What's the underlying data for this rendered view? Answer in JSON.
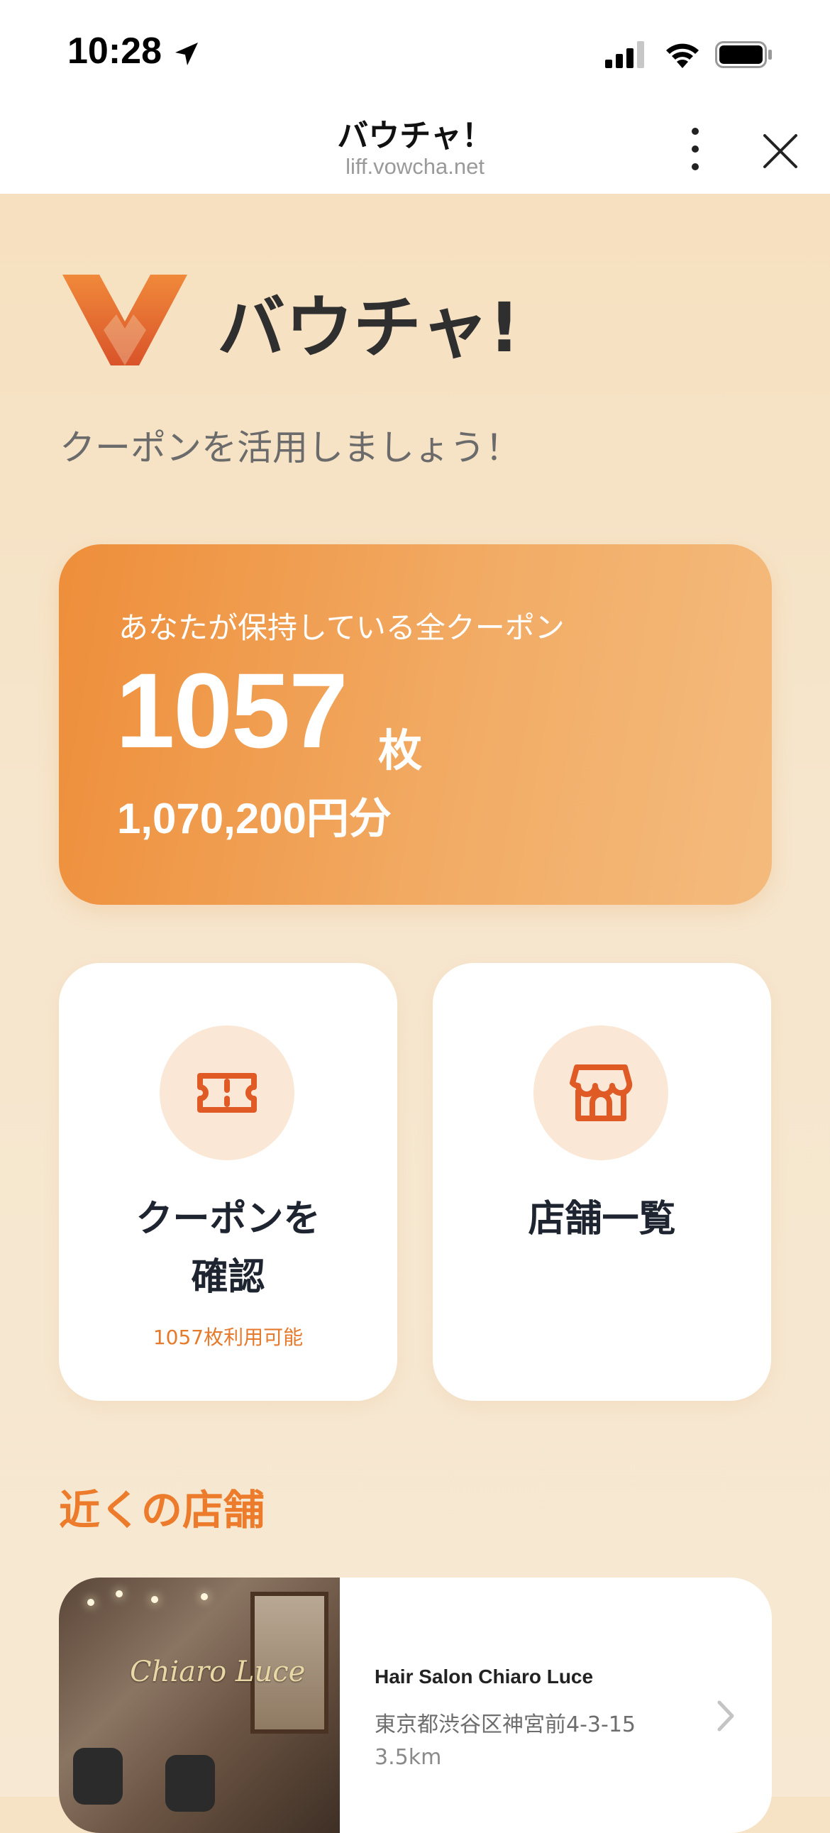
{
  "status_bar": {
    "time": "10:28"
  },
  "browser_header": {
    "title": "バウチャ！",
    "url": "liff.vowcha.net"
  },
  "logo": {
    "text": "バウチャ!"
  },
  "subtitle": "クーポンを活用しましょう！",
  "summary": {
    "label": "あなたが保持している全クーポン",
    "count": "1057",
    "unit": "枚",
    "value": "1,070,200円分"
  },
  "tiles": [
    {
      "title_line1": "クーポンを",
      "title_line2": "確認",
      "sub": "1057枚利用可能",
      "icon": "ticket-icon"
    },
    {
      "title_line1": "店舗一覧",
      "title_line2": "",
      "sub": "",
      "icon": "store-icon"
    }
  ],
  "nearby": {
    "section_title": "近くの店舗",
    "stores": [
      {
        "name": "Hair Salon Chiaro Luce",
        "address": "東京都渋谷区神宮前4-3-15",
        "distance": "3.5km",
        "image_logo_text": "Chiaro Luce"
      }
    ]
  },
  "colors": {
    "accent": "#ec7c2b",
    "card_gradient_start": "#ee8e3a",
    "card_gradient_end": "#f4bb7d",
    "background": "#f6e3c6"
  }
}
